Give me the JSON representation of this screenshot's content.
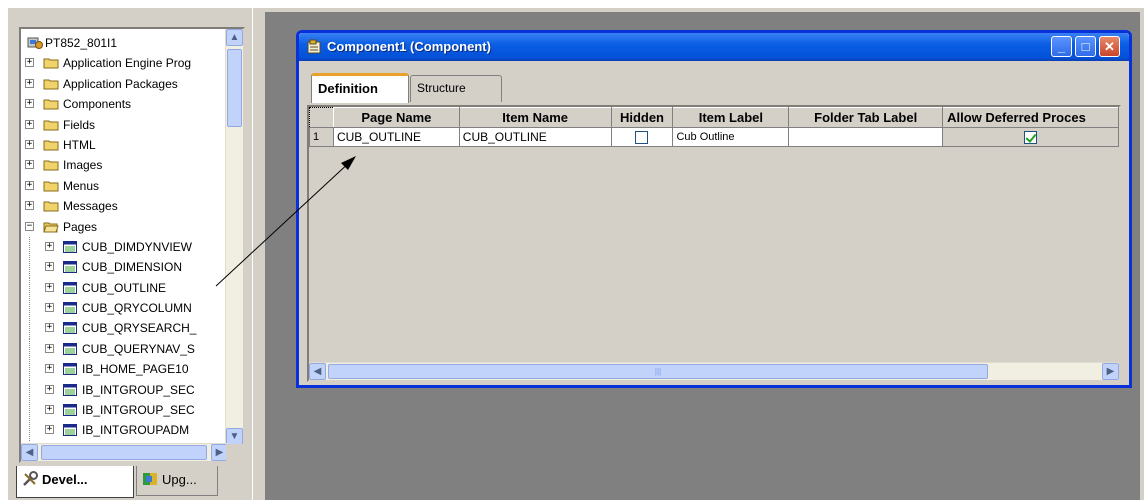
{
  "project_tree": {
    "root_label": "PT852_801I1",
    "folders": [
      {
        "label": "Application Engine Prog",
        "state": "collapsed"
      },
      {
        "label": "Application Packages",
        "state": "collapsed"
      },
      {
        "label": "Components",
        "state": "collapsed"
      },
      {
        "label": "Fields",
        "state": "collapsed"
      },
      {
        "label": "HTML",
        "state": "collapsed"
      },
      {
        "label": "Images",
        "state": "collapsed"
      },
      {
        "label": "Menus",
        "state": "collapsed"
      },
      {
        "label": "Messages",
        "state": "collapsed"
      },
      {
        "label": "Pages",
        "state": "expanded"
      }
    ],
    "pages": [
      "CUB_DIMDYNVIEW",
      "CUB_DIMENSION",
      "CUB_OUTLINE",
      "CUB_QRYCOLUMN",
      "CUB_QRYSEARCH_",
      "CUB_QUERYNAV_S",
      "IB_HOME_PAGE10",
      "IB_INTGROUP_SEC",
      "IB_INTGROUP_SEC",
      "IB_INTGROUPADM"
    ]
  },
  "bottom_tabs": [
    {
      "label": "Devel...",
      "icon": "development-icon",
      "active": true
    },
    {
      "label": "Upg...",
      "icon": "upgrade-icon",
      "active": false
    }
  ],
  "window": {
    "title": "Component1 (Component)",
    "controls": {
      "minimize": "_",
      "maximize": "□",
      "close": "✕"
    },
    "tabs": [
      {
        "label": "Definition",
        "active": true
      },
      {
        "label": "Structure",
        "active": false
      }
    ],
    "grid": {
      "columns": [
        "Page Name",
        "Item Name",
        "Hidden",
        "Item Label",
        "Folder Tab Label",
        "Allow Deferred Proces"
      ],
      "rows": [
        {
          "num": "1",
          "page_name": "CUB_OUTLINE",
          "item_name": "CUB_OUTLINE",
          "hidden": false,
          "item_label": "Cub Outline",
          "folder_tab_label": "",
          "allow_deferred": true
        }
      ]
    }
  },
  "colors": {
    "xp_titlebar": "#0a5fe4",
    "dialog_face": "#d4d0c8",
    "mdi_background": "#808080",
    "tab_highlight": "#e8a22a"
  }
}
